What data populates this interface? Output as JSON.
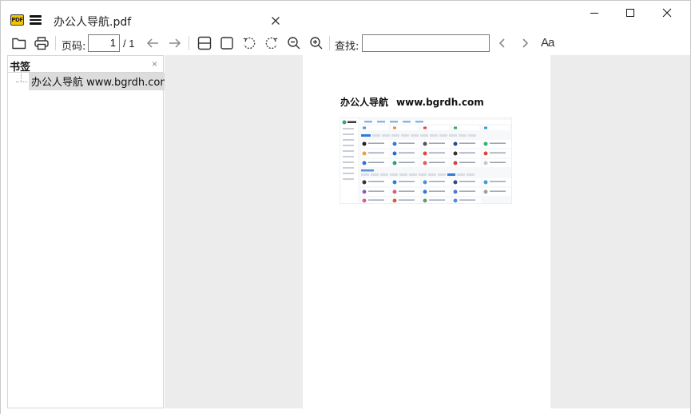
{
  "window": {
    "logo_text": "PDF",
    "tab_title": "办公人导航.pdf",
    "icons": {
      "menu": "hamburger-icon",
      "tab_close": "close-icon",
      "minimize": "minimize-icon",
      "maximize": "maximize-icon",
      "close": "close-icon"
    }
  },
  "toolbar": {
    "page_label": "页码:",
    "page_value": "1",
    "page_total": "/ 1",
    "search_label": "查找:",
    "search_value": "",
    "font_label": "Aa",
    "icons": [
      "open-folder-icon",
      "print-icon",
      "previous-page-icon",
      "next-page-icon",
      "fit-width-icon",
      "fit-page-icon",
      "rotate-left-icon",
      "rotate-right-icon",
      "zoom-out-icon",
      "zoom-in-icon",
      "search-prev-icon",
      "search-next-icon",
      "font-size-icon"
    ]
  },
  "sidebar": {
    "title": "书签",
    "close_glyph": "×",
    "bookmarks": [
      {
        "label": "办公人导航 www.bgrdh.com"
      }
    ]
  },
  "document": {
    "heading_cn": "办公人导航",
    "heading_url": "www.bgrdh.com",
    "thumbnail": "website-screenshot-thumbnail"
  },
  "colors": {
    "accent_logo": "#f2c400",
    "viewer_bg": "#ececec",
    "selection_bg": "#dcdcdc",
    "thumb_accent": "#2f7bd9"
  }
}
